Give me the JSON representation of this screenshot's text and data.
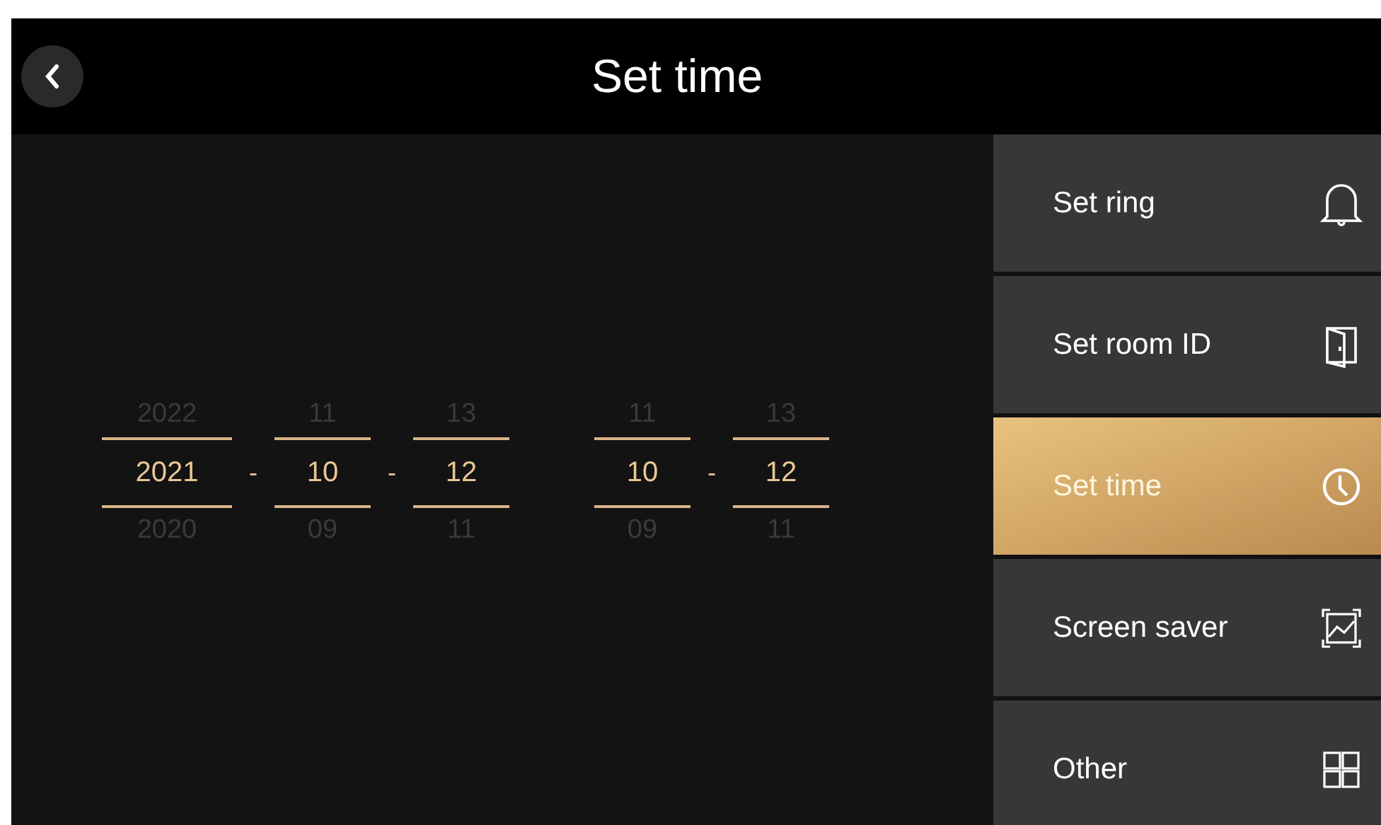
{
  "header": {
    "title": "Set time"
  },
  "date_picker": {
    "columns": [
      {
        "prev": "2022",
        "value": "2021",
        "next": "2020",
        "kind": "year"
      },
      {
        "prev": "11",
        "value": "10",
        "next": "09",
        "kind": "short"
      },
      {
        "prev": "13",
        "value": "12",
        "next": "11",
        "kind": "short"
      }
    ],
    "separators": [
      "-",
      "-"
    ]
  },
  "time_picker": {
    "columns": [
      {
        "prev": "11",
        "value": "10",
        "next": "09",
        "kind": "short"
      },
      {
        "prev": "13",
        "value": "12",
        "next": "11",
        "kind": "short"
      }
    ],
    "separators": [
      "-"
    ]
  },
  "sidebar": {
    "items": [
      {
        "label": "Set ring",
        "kind": "bell",
        "selected": false
      },
      {
        "label": "Set room ID",
        "kind": "door",
        "selected": false
      },
      {
        "label": "Set time",
        "kind": "clock",
        "selected": true
      },
      {
        "label": "Screen saver",
        "kind": "frame",
        "selected": false
      },
      {
        "label": "Other",
        "kind": "grid",
        "selected": false
      }
    ]
  }
}
